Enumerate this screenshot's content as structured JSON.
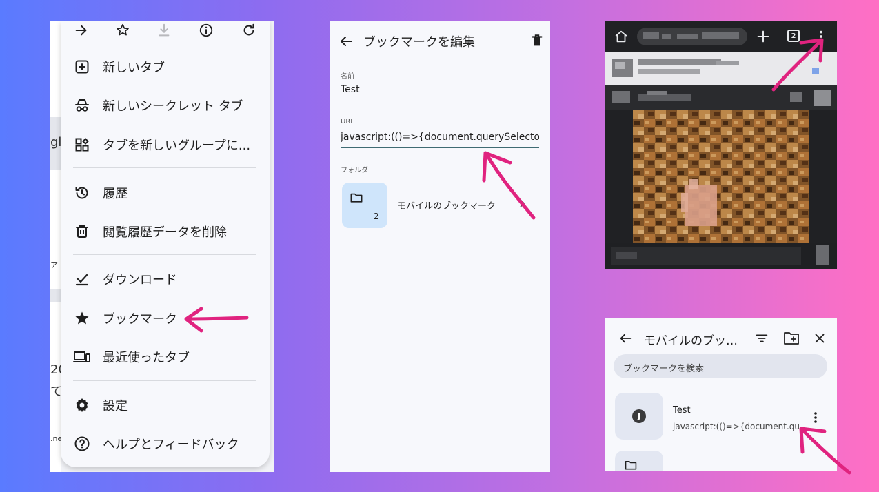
{
  "colors": {
    "accent_pink": "#e0237f",
    "folder_card": "#cfe5fb",
    "focus_underline": "#3f6b73",
    "icon_dark": "#1f1f1f"
  },
  "chrome_menu": {
    "toolbar_icons": [
      "forward-arrow-icon",
      "star-outline-icon",
      "download-icon",
      "info-icon",
      "reload-icon"
    ],
    "items": [
      {
        "label": "新しいタブ",
        "icon": "new-tab-icon"
      },
      {
        "label": "新しいシークレット タブ",
        "icon": "incognito-icon"
      },
      {
        "label": "タブを新しいグループに...",
        "icon": "tab-group-icon"
      },
      {
        "label": "履歴",
        "icon": "history-icon"
      },
      {
        "label": "閲覧履歴データを削除",
        "icon": "trash-icon"
      },
      {
        "label": "ダウンロード",
        "icon": "download-done-icon"
      },
      {
        "label": "ブックマーク",
        "icon": "star-filled-icon"
      },
      {
        "label": "最近使ったタブ",
        "icon": "devices-icon"
      },
      {
        "label": "設定",
        "icon": "gear-icon"
      },
      {
        "label": "ヘルプとフィードバック",
        "icon": "help-icon"
      }
    ],
    "behind_fragments": [
      "gle",
      "ア",
      "20",
      "て",
      ".ne"
    ]
  },
  "edit_bookmark": {
    "title": "ブックマークを編集",
    "name_label": "名前",
    "name_value": "Test",
    "url_label": "URL",
    "url_value": "javascript:(()=>{document.querySelectorAll('vide",
    "folder_label": "フォルダ",
    "folder_name": "モバイルのブックマーク",
    "folder_count": "2"
  },
  "browser": {
    "tab_count": "2"
  },
  "mobile_bookmarks": {
    "title": "モバイルのブッ…",
    "search_placeholder": "ブックマークを検索",
    "item": {
      "avatar_letter": "J",
      "name": "Test",
      "url": "javascript:(()=>{document.qu..."
    }
  }
}
